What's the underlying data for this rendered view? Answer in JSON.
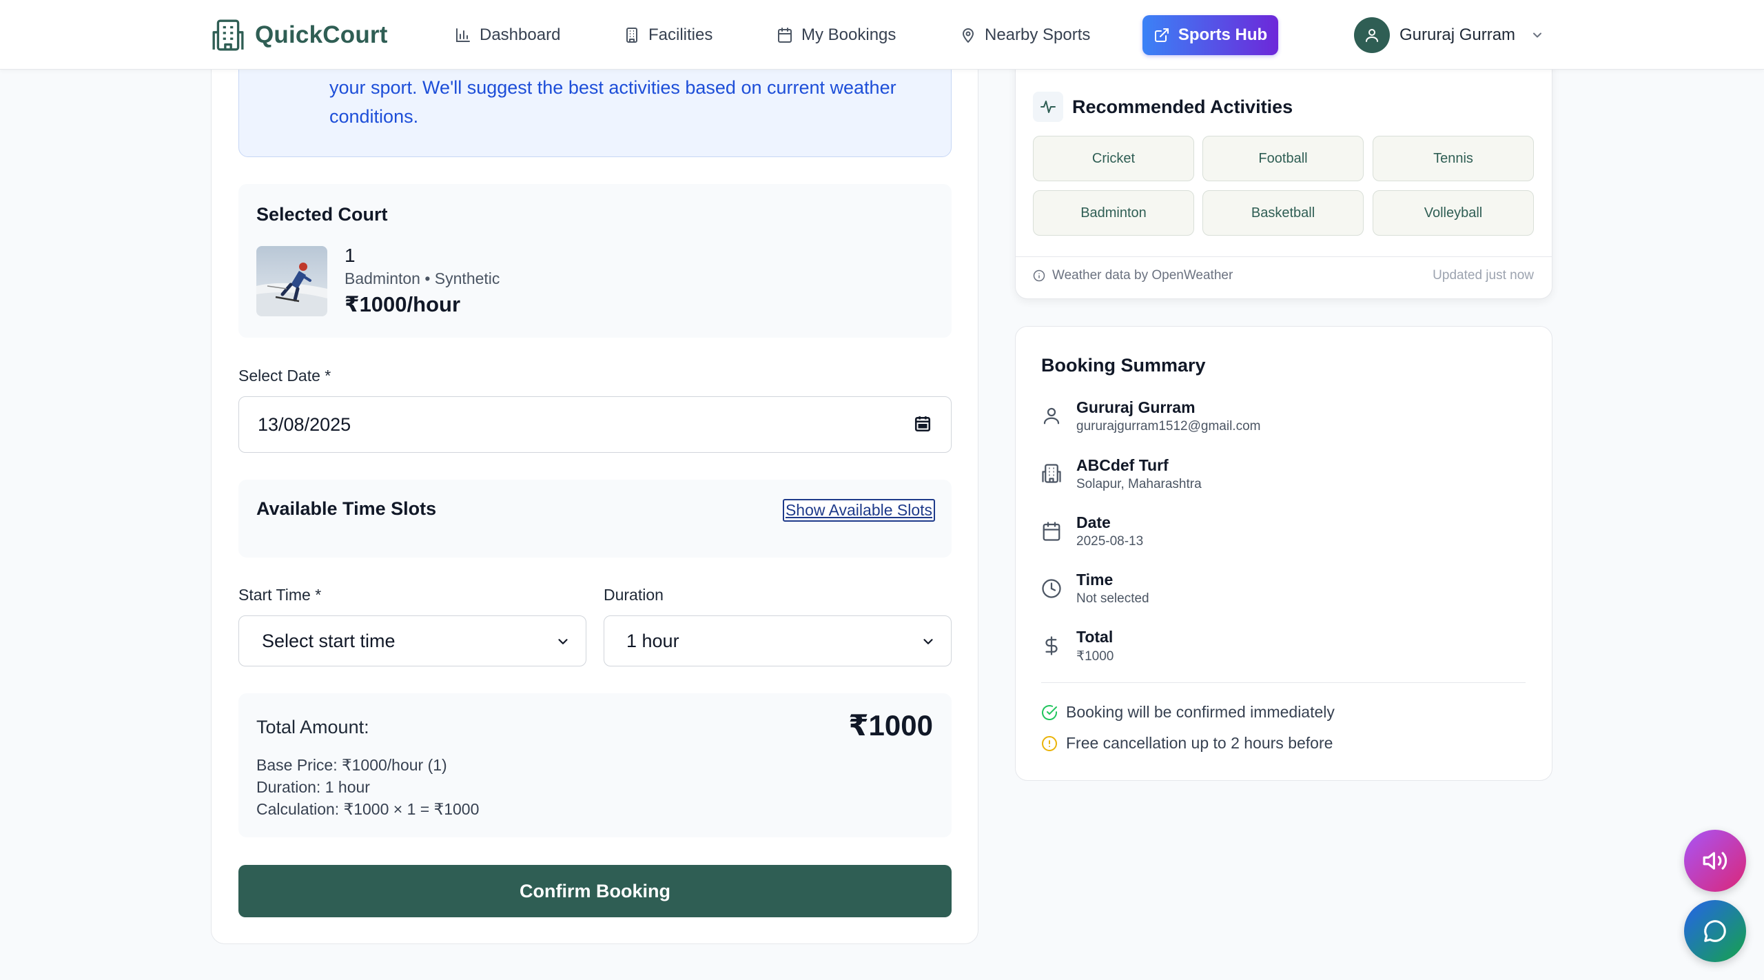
{
  "nav": {
    "brand": "QuickCourt",
    "items": [
      {
        "label": "Dashboard",
        "icon": "bar-chart-icon"
      },
      {
        "label": "Facilities",
        "icon": "building-icon"
      },
      {
        "label": "My Bookings",
        "icon": "calendar-icon"
      },
      {
        "label": "Nearby Sports",
        "icon": "map-pin-icon"
      }
    ],
    "hub_label": "Sports Hub",
    "user_name": "Gururaj Gurram"
  },
  "info": {
    "text": "your sport. We'll suggest the best activities based on current weather conditions."
  },
  "selected_court": {
    "title": "Selected Court",
    "name": "1",
    "type": "Badminton • Synthetic",
    "price": "₹1000/hour"
  },
  "date": {
    "label": "Select Date *",
    "value": "13/08/2025"
  },
  "slots": {
    "title": "Available Time Slots",
    "button": "Show Available Slots"
  },
  "start_time": {
    "label": "Start Time *",
    "value": "Select start time"
  },
  "duration": {
    "label": "Duration",
    "value": "1 hour"
  },
  "total": {
    "label": "Total Amount:",
    "value": "₹1000",
    "base": "Base Price: ₹1000/hour (1)",
    "duration": "Duration: 1 hour",
    "calculation": "Calculation: ₹1000 × 1 = ₹1000"
  },
  "confirm_label": "Confirm Booking",
  "weather": {
    "title": "Recommended Activities",
    "activities": [
      "Cricket",
      "Football",
      "Tennis",
      "Badminton",
      "Basketball",
      "Volleyball"
    ],
    "attribution": "Weather data by OpenWeather",
    "updated": "Updated just now"
  },
  "summary": {
    "title": "Booking Summary",
    "user_name": "Gururaj Gurram",
    "user_email": "gururajgurram1512@gmail.com",
    "facility_name": "ABCdef Turf",
    "facility_location": "Solapur, Maharashtra",
    "date_label": "Date",
    "date_value": "2025-08-13",
    "time_label": "Time",
    "time_value": "Not selected",
    "total_label": "Total",
    "total_value": "₹1000",
    "note_confirm": "Booking will be confirmed immediately",
    "note_cancel": "Free cancellation up to 2 hours before"
  },
  "colors": {
    "brand": "#2f5e54",
    "hub_gradient_start": "#3b82f6",
    "hub_gradient_end": "#6d28d9",
    "info_text": "#1d4ed8",
    "success": "#22c55e",
    "warning": "#eab308"
  }
}
